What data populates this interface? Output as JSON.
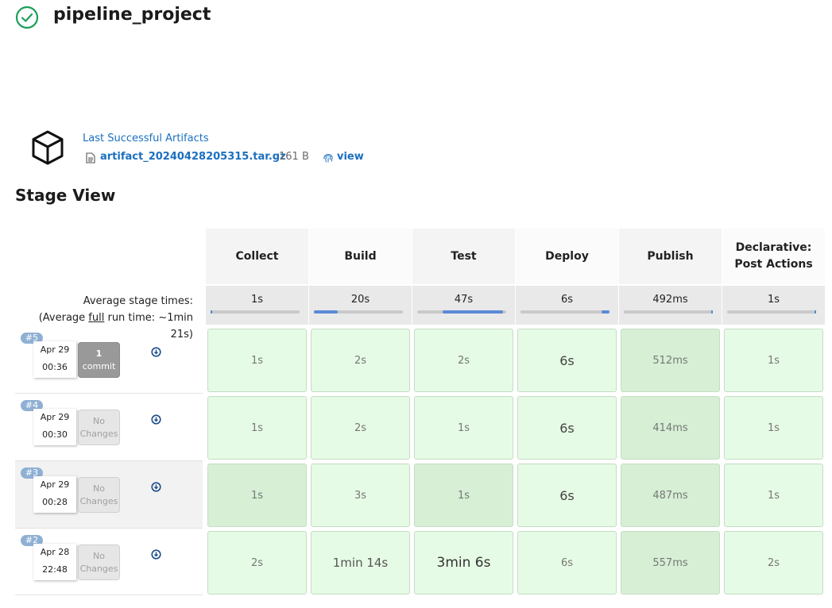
{
  "header": {
    "title": "pipeline_project",
    "status_icon": "check-circle-icon",
    "status_color": "#1e9e5a"
  },
  "artifacts": {
    "heading": "Last Successful Artifacts",
    "file_name": "artifact_20240428205315.tar.gz",
    "file_size": "161 B",
    "view_label": "view"
  },
  "stage_view": {
    "title": "Stage View",
    "avg_label_line1": "Average stage times:",
    "avg_label_pre": "(Average ",
    "avg_label_full": "full",
    "avg_label_post": " run time: ~1min",
    "avg_label_line3": "21s)",
    "stages": [
      {
        "name": "Collect",
        "avg": "1s",
        "progress": 0.0
      },
      {
        "name": "Build",
        "avg": "20s",
        "progress": 0.27
      },
      {
        "name": "Test",
        "avg": "47s",
        "progress": 0.68
      },
      {
        "name": "Deploy",
        "avg": "6s",
        "progress": 0.09
      },
      {
        "name": "Publish",
        "avg": "492ms",
        "progress": 0.0
      },
      {
        "name": "Declarative: Post Actions",
        "avg": "1s",
        "progress": 0.0
      }
    ],
    "builds": [
      {
        "number": "#5",
        "date": "Apr 29",
        "time": "00:36",
        "changes_count": "1",
        "changes_label": "commit",
        "durations": [
          "1s",
          "2s",
          "2s",
          "6s",
          "512ms",
          "1s"
        ]
      },
      {
        "number": "#4",
        "date": "Apr 29",
        "time": "00:30",
        "changes_count": "",
        "changes_label": "No Changes",
        "durations": [
          "1s",
          "2s",
          "1s",
          "6s",
          "414ms",
          "1s"
        ]
      },
      {
        "number": "#3",
        "date": "Apr 29",
        "time": "00:28",
        "changes_count": "",
        "changes_label": "No Changes",
        "durations": [
          "1s",
          "3s",
          "1s",
          "6s",
          "487ms",
          "1s"
        ]
      },
      {
        "number": "#2",
        "date": "Apr 28",
        "time": "22:48",
        "changes_count": "",
        "changes_label": "No Changes",
        "durations": [
          "2s",
          "1min 14s",
          "3min 6s",
          "6s",
          "557ms",
          "2s"
        ]
      }
    ]
  }
}
